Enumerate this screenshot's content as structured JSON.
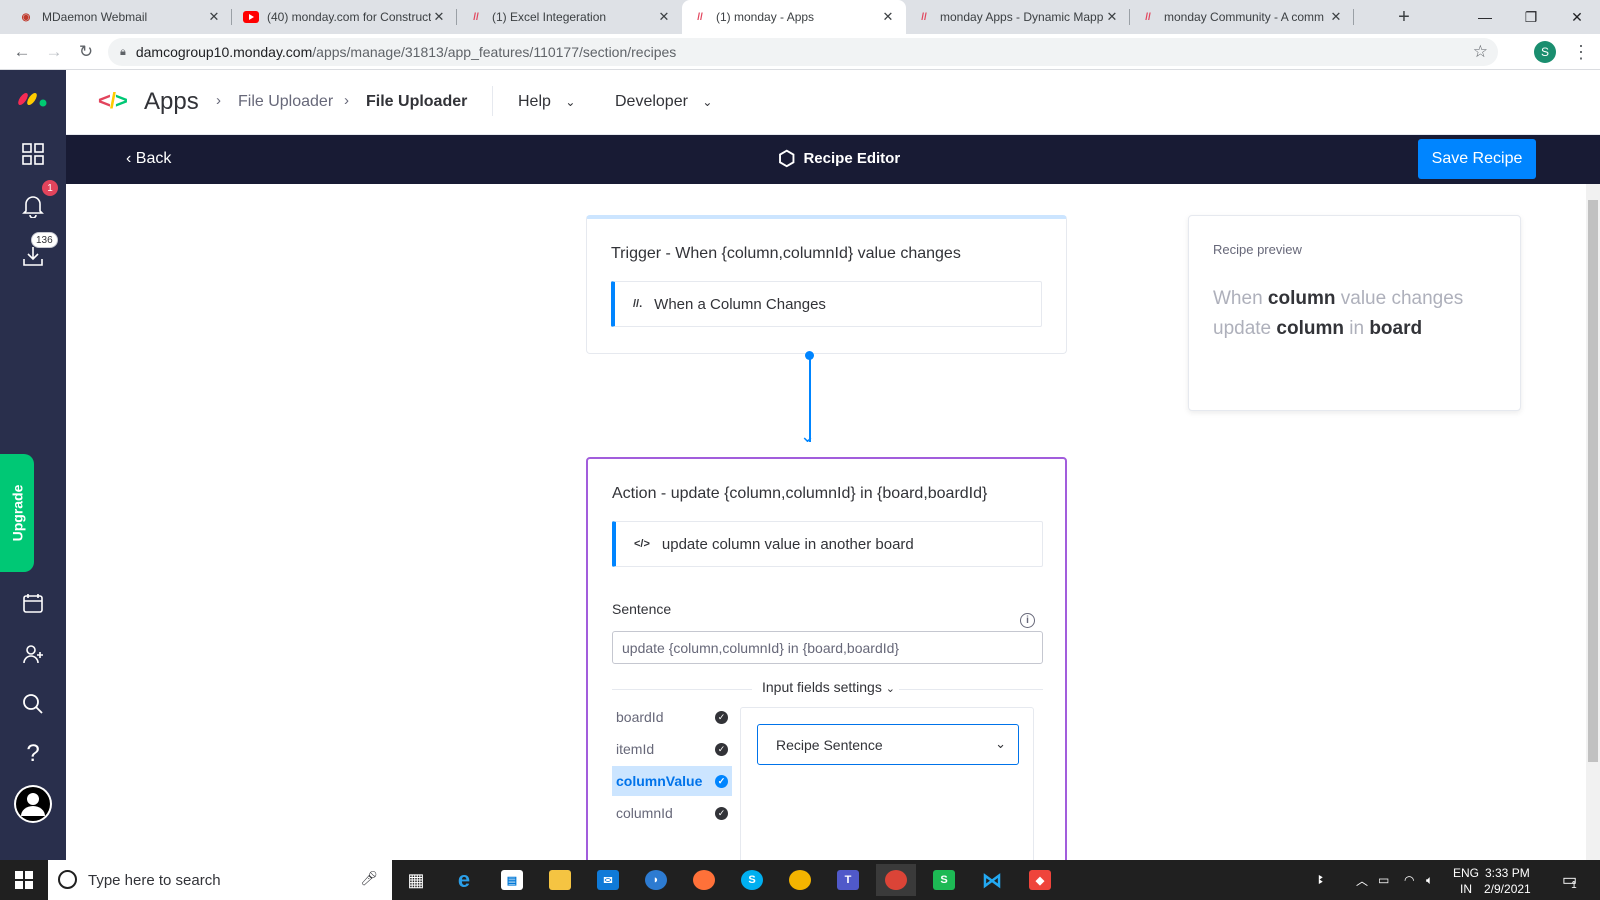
{
  "browser": {
    "tabs": [
      {
        "title": "MDaemon Webmail",
        "active": false
      },
      {
        "title": "(40) monday.com for Construct",
        "active": false
      },
      {
        "title": "(1) Excel Integeration",
        "active": false
      },
      {
        "title": "(1) monday - Apps",
        "active": true
      },
      {
        "title": "monday Apps - Dynamic Mapp",
        "active": false
      },
      {
        "title": "monday Community - A comm",
        "active": false
      }
    ],
    "new_tab": "+",
    "url_host": "damcogroup10.monday.com",
    "url_path": "/apps/manage/31813/app_features/110177/section/recipes",
    "profile_initial": "S"
  },
  "rail": {
    "notifications_badge": "1",
    "inbox_badge": "136",
    "upgrade_label": "Upgrade"
  },
  "header": {
    "apps_label": "Apps",
    "breadcrumb": [
      "File Uploader",
      "File Uploader"
    ],
    "menus": [
      "Help",
      "Developer"
    ]
  },
  "editor_bar": {
    "back_label": "Back",
    "title": "Recipe Editor",
    "save_label": "Save Recipe"
  },
  "trigger": {
    "title": "Trigger - When {column,columnId} value changes",
    "block_label": "When a Column Changes"
  },
  "action": {
    "title": "Action - update {column,columnId} in {board,boardId}",
    "block_label": "update column value in another board",
    "sentence_label": "Sentence",
    "sentence_value": "update {column,columnId} in {board,boardId}",
    "input_fields_label": "Input fields settings",
    "fields": [
      {
        "name": "boardId",
        "selected": false
      },
      {
        "name": "itemId",
        "selected": false
      },
      {
        "name": "columnValue",
        "selected": true
      },
      {
        "name": "columnId",
        "selected": false
      }
    ],
    "dropdown_value": "Recipe Sentence"
  },
  "preview": {
    "title": "Recipe preview",
    "words": [
      "When",
      "column",
      "value changes",
      "update",
      "column",
      "in",
      "board"
    ]
  },
  "taskbar": {
    "search_placeholder": "Type here to search",
    "lang_line1": "ENG",
    "lang_line2": "IN",
    "time": "3:33 PM",
    "date": "2/9/2021",
    "notif_count": "1"
  },
  "colors": {
    "rail": "#292f4c",
    "editor_bar": "#181b34",
    "primary": "#0085ff",
    "action_border": "#a25ddc",
    "upgrade": "#00c875"
  }
}
